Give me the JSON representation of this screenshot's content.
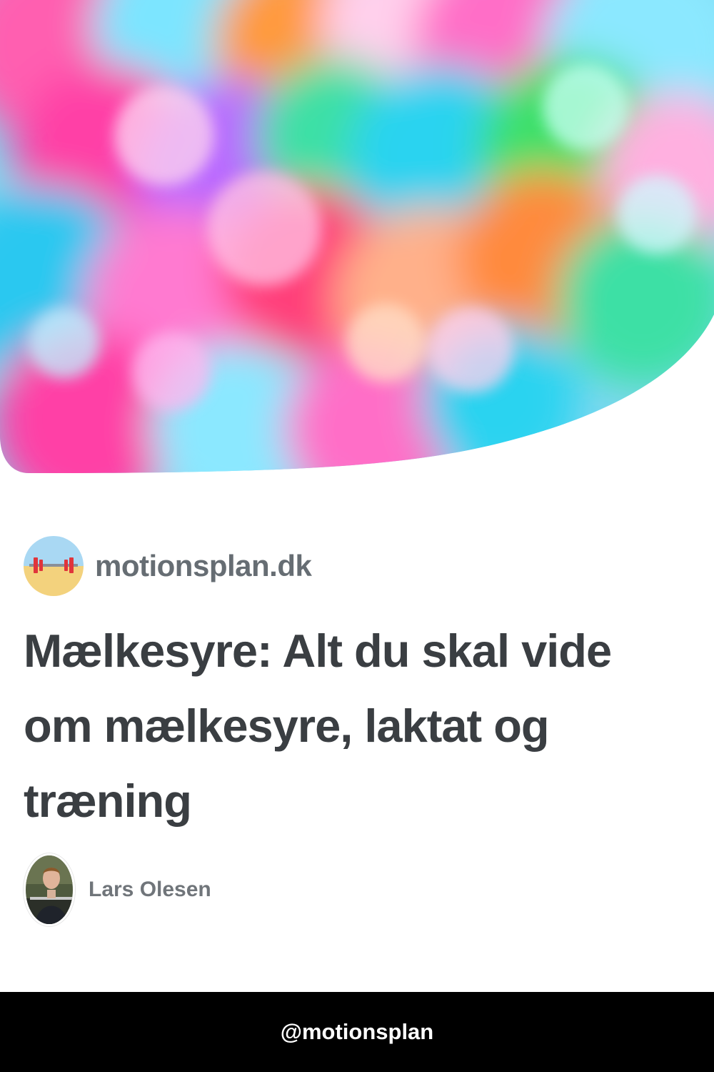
{
  "hero": {
    "image_name": "colorful-bokeh-image",
    "colors": [
      "#ff3fa6",
      "#29d3f0",
      "#3ee0a5",
      "#ff9a3c",
      "#ff6ec7",
      "#8be8ff",
      "#b96bff"
    ]
  },
  "site": {
    "logo_icon": "barbell-beach-icon",
    "name": "motionsplan.dk"
  },
  "article": {
    "title": "Mælkesyre: Alt du skal vide om mælkesyre, laktat og træning"
  },
  "author": {
    "avatar_icon": "person-photo-icon",
    "name": "Lars Olesen"
  },
  "footer": {
    "handle": "@motionsplan"
  },
  "colors": {
    "title": "#3a3e42",
    "meta": "#666d73",
    "footer_bg": "#000000"
  }
}
